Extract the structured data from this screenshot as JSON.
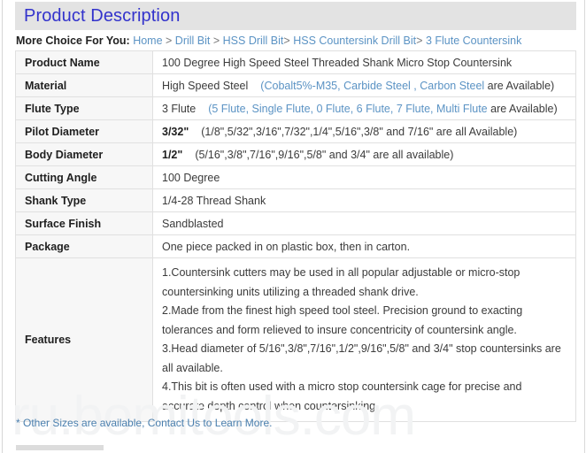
{
  "header": {
    "title": "Product Description",
    "band_color": "#e3e3e3",
    "title_color": "#3333cc"
  },
  "breadcrumb": {
    "lead": "More Choice For You:",
    "items": [
      {
        "label": "Home",
        "sep": ">"
      },
      {
        "label": "Drill Bit",
        "sep": ">"
      },
      {
        "label": "HSS Drill Bit",
        "sep": ">"
      },
      {
        "label": "HSS Countersink Drill Bit",
        "sep": ">"
      },
      {
        "label": "3 Flute Countersink",
        "sep": ""
      }
    ],
    "link_color": "#5b93c4"
  },
  "spec_table": {
    "rows": [
      {
        "label": "Product Name",
        "value_main": "100 Degree High Speed Steel Threaded Shank Micro Stop Countersink",
        "value_main_bold": false,
        "value_blue": "",
        "value_tail": ""
      },
      {
        "label": "Material",
        "value_main": "High Speed Steel",
        "value_main_bold": false,
        "value_blue": "(Cobalt5%-M35, Carbide Steel , Carbon Steel",
        "value_tail": " are Available)"
      },
      {
        "label": "Flute Type",
        "value_main": "3 Flute",
        "value_main_bold": false,
        "value_blue": "(5 Flute, Single Flute, 0 Flute,  6 Flute, 7 Flute,  Multi Flute",
        "value_tail": " are Available)"
      },
      {
        "label": "Pilot Diameter",
        "value_main": "3/32\"",
        "value_main_bold": true,
        "value_blue": "",
        "value_tail": "(1/8\",5/32\",3/16\",7/32\",1/4\",5/16\",3/8\" and 7/16\" are all Available)"
      },
      {
        "label": "Body Diameter",
        "value_main": "1/2\"",
        "value_main_bold": true,
        "value_blue": "",
        "value_tail": "(5/16\",3/8\",7/16\",9/16\",5/8\" and 3/4\" are all available)"
      },
      {
        "label": "Cutting Angle",
        "value_main": "100 Degree",
        "value_main_bold": false,
        "value_blue": "",
        "value_tail": ""
      },
      {
        "label": "Shank Type",
        "value_main": "1/4-28 Thread Shank",
        "value_main_bold": false,
        "value_blue": "",
        "value_tail": ""
      },
      {
        "label": "Surface Finish",
        "value_main": "Sandblasted",
        "value_main_bold": false,
        "value_blue": "",
        "value_tail": ""
      },
      {
        "label": "Package",
        "value_main": "One piece packed in on plastic box, then in carton.",
        "value_main_bold": false,
        "value_blue": "",
        "value_tail": ""
      }
    ],
    "features": {
      "label": "Features",
      "text": "1.Countersink cutters may be used in all popular adjustable or micro-stop countersinking units utilizing a threaded shank drive.\n2.Made from the finest high speed tool steel. Precision ground to exacting tolerances and form relieved to insure concentricity of countersink angle.\n3.Head diameter of 5/16\",3/8\",7/16\",1/2\",9/16\",5/8\" and 3/4\" stop countersinks are all available.\n4.This bit is often used with a micro stop countersink cage for precise and accurate depth control when countersinking."
    }
  },
  "footer": {
    "note": "* Other Sizes are available, Contact Us to Learn More.",
    "note_color": "#4a7fae"
  },
  "watermark": {
    "text": "ru.bomitools.com",
    "color": "#f2f3f4"
  }
}
